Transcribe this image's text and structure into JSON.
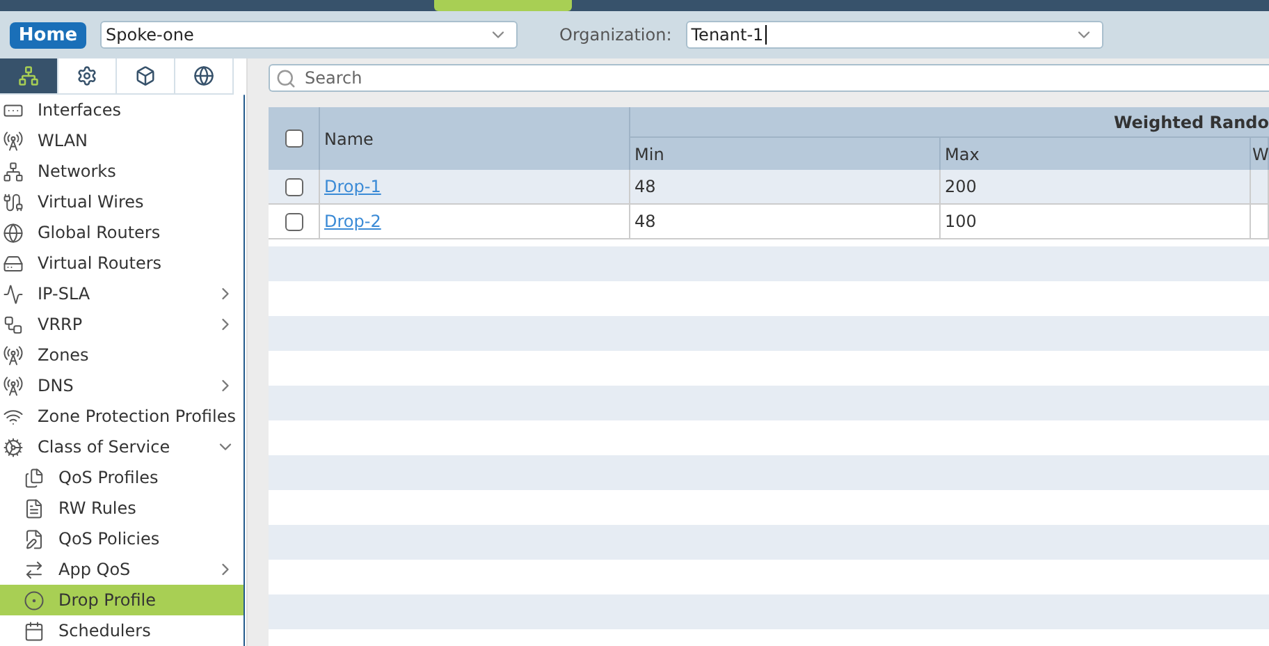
{
  "header": {
    "home_button": "Home",
    "device": "Spoke-one",
    "organization_label": "Organization:",
    "organization": "Tenant-1"
  },
  "sidebar_tabs": [
    {
      "selected": true
    },
    {
      "selected": false
    },
    {
      "selected": false
    },
    {
      "selected": false
    }
  ],
  "sidebar": {
    "items": [
      {
        "label": "Interfaces",
        "selected": false
      },
      {
        "label": "WLAN",
        "selected": false
      },
      {
        "label": "Networks",
        "selected": false
      },
      {
        "label": "Virtual Wires",
        "selected": false
      },
      {
        "label": "Global Routers",
        "selected": false
      },
      {
        "label": "Virtual Routers",
        "selected": false
      },
      {
        "label": "IP-SLA",
        "selected": false,
        "expanded": false
      },
      {
        "label": "VRRP",
        "selected": false,
        "expanded": false
      },
      {
        "label": "Zones",
        "selected": false
      },
      {
        "label": "DNS",
        "selected": false,
        "expanded": false
      },
      {
        "label": "Zone Protection Profiles",
        "selected": false
      },
      {
        "label": "Class of Service",
        "selected": false,
        "expanded": true,
        "children": [
          {
            "label": "QoS Profiles",
            "selected": false
          },
          {
            "label": "RW Rules",
            "selected": false
          },
          {
            "label": "QoS Policies",
            "selected": false
          },
          {
            "label": "App QoS",
            "selected": false,
            "expanded": false
          },
          {
            "label": "Drop Profile",
            "selected": true
          },
          {
            "label": "Schedulers",
            "selected": false
          }
        ]
      }
    ]
  },
  "search": {
    "placeholder": "Search"
  },
  "table": {
    "select_all": {
      "checked": false
    },
    "group_header": "Weighted Rando",
    "columns": [
      "Name",
      "Min",
      "Max",
      "W"
    ],
    "rows": [
      {
        "checked": false,
        "name": "Drop-1",
        "min": "48",
        "max": "200"
      },
      {
        "checked": false,
        "name": "Drop-2",
        "min": "48",
        "max": "100"
      }
    ]
  }
}
